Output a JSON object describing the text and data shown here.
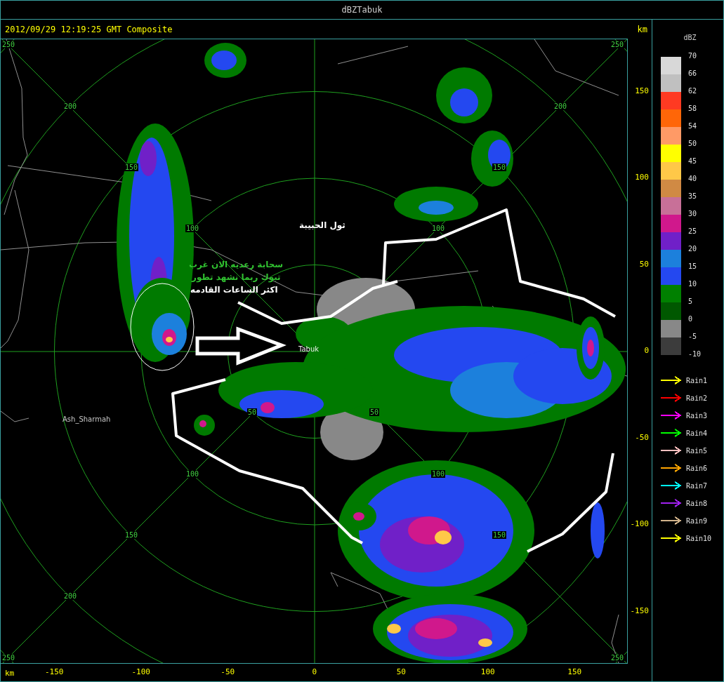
{
  "window": {
    "title": "dBZTabuk"
  },
  "header": {
    "timestamp": "2012/09/29 12:19:25 GMT Composite",
    "unit": "km"
  },
  "map": {
    "ring_labels": [
      {
        "text": "250"
      },
      {
        "text": "200"
      },
      {
        "text": "150"
      },
      {
        "text": "100"
      },
      {
        "text": "250"
      },
      {
        "text": "200"
      },
      {
        "text": "150"
      },
      {
        "text": "100"
      },
      {
        "text": "50"
      },
      {
        "text": "100"
      },
      {
        "text": "150"
      },
      {
        "text": "200"
      },
      {
        "text": "250"
      },
      {
        "text": "50"
      },
      {
        "text": "100"
      },
      {
        "text": "150"
      },
      {
        "text": "250"
      }
    ],
    "places": [
      {
        "kind": "city",
        "text": "Tabuk"
      },
      {
        "kind": "town",
        "text": "Ash_Sharmah"
      }
    ],
    "annotations": [
      {
        "kind": "note",
        "text": "سحابة رعديه الان غرب"
      },
      {
        "kind": "note",
        "text": "تبوك ربما نشهد تطور"
      },
      {
        "kind": "highlight",
        "text": "اكثر الساعات القادمه"
      },
      {
        "kind": "title",
        "text": "ثول الحبيبة"
      }
    ]
  },
  "y_axis": {
    "ticks": [
      "150",
      "100",
      "50",
      "0",
      "-50",
      "-100",
      "-150"
    ]
  },
  "x_axis": {
    "unit": "km",
    "ticks": [
      "-150",
      "-100",
      "-50",
      "0",
      "50",
      "100",
      "150"
    ]
  },
  "legend": {
    "title": "dBZ",
    "labels": [
      "70",
      "66",
      "62",
      "58",
      "54",
      "50",
      "45",
      "40",
      "35",
      "30",
      "25",
      "20",
      "15",
      "10",
      "5",
      "0",
      "-5",
      "-10"
    ],
    "bins": [
      {
        "color": "#d8d8d8"
      },
      {
        "color": "#c0c0c0"
      },
      {
        "color": "#ff3a22"
      },
      {
        "color": "#ff6608"
      },
      {
        "color": "#ff9a66"
      },
      {
        "color": "#ffff00"
      },
      {
        "color": "#ffc848"
      },
      {
        "color": "#d08a44"
      },
      {
        "color": "#c87098"
      },
      {
        "color": "#d0188c"
      },
      {
        "color": "#7020c8"
      },
      {
        "color": "#1c80dc"
      },
      {
        "color": "#2448f0"
      },
      {
        "color": "#008000"
      },
      {
        "color": "#005800"
      },
      {
        "color": "#888888"
      },
      {
        "color": "#3c3c3c"
      }
    ],
    "tracks": [
      {
        "label": "Rain1",
        "color": "#ffff00"
      },
      {
        "label": "Rain2",
        "color": "#ff0000"
      },
      {
        "label": "Rain3",
        "color": "#ff00ff"
      },
      {
        "label": "Rain4",
        "color": "#00ff00"
      },
      {
        "label": "Rain5",
        "color": "#ffc0c0"
      },
      {
        "label": "Rain6",
        "color": "#ffa500"
      },
      {
        "label": "Rain7",
        "color": "#00ffff"
      },
      {
        "label": "Rain8",
        "color": "#a020f0"
      },
      {
        "label": "Rain9",
        "color": "#d2b48c"
      },
      {
        "label": "Rain10",
        "color": "#ffff00"
      }
    ]
  }
}
